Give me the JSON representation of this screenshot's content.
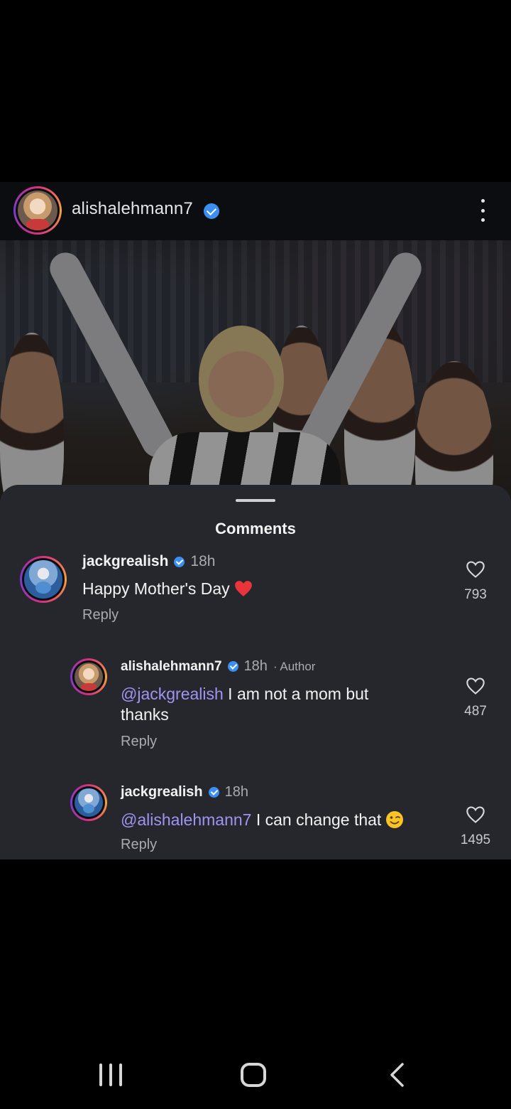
{
  "post": {
    "username": "alishalehmann7",
    "verified": true,
    "photo_subject": "team celebration"
  },
  "comments_sheet": {
    "title": "Comments",
    "comments": [
      {
        "username": "jackgrealish",
        "time": "18h",
        "author_tag": "",
        "mention": "",
        "text": "Happy Mother's Day",
        "emoji": "red-heart",
        "reply_label": "Reply",
        "likes": "793"
      },
      {
        "username": "alishalehmann7",
        "time": "18h",
        "author_tag": "· Author",
        "mention": "@jackgrealish",
        "text": " I am not a mom but thanks",
        "emoji": "",
        "reply_label": "Reply",
        "likes": "487"
      },
      {
        "username": "jackgrealish",
        "time": "18h",
        "author_tag": "",
        "mention": "@alishalehmann7",
        "text": " I can change that",
        "emoji": "winking-face",
        "reply_label": "Reply",
        "likes": "1495"
      }
    ]
  },
  "colors": {
    "sheet_bg": "#25272d",
    "mention": "#9e95f2",
    "verified": "#3a8ff0",
    "heart": "#e8343a"
  },
  "icons": {
    "more": "more-vertical-icon",
    "like": "heart-outline-icon",
    "nav_recent": "recent-apps-icon",
    "nav_home": "home-icon",
    "nav_back": "back-icon"
  }
}
